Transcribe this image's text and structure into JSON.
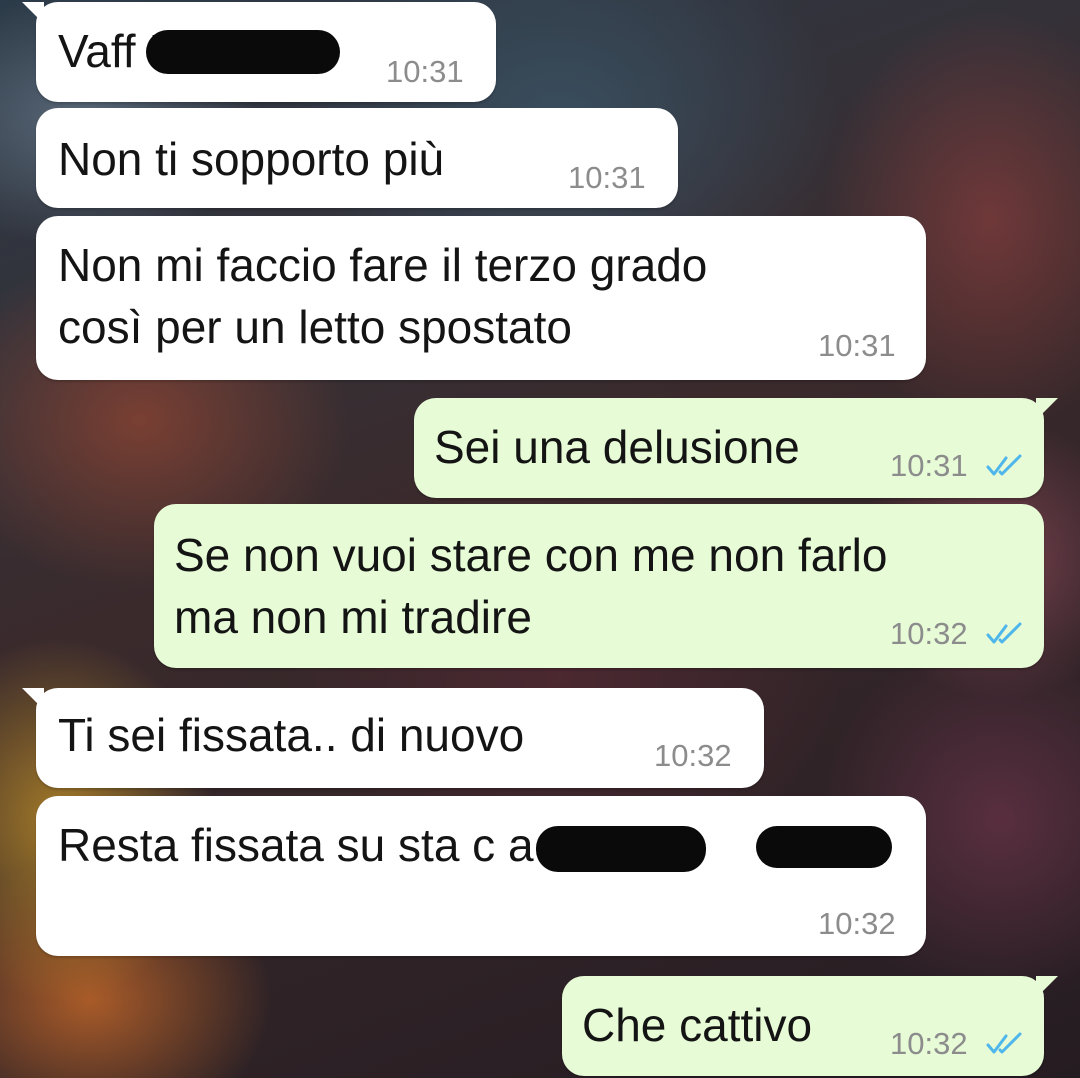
{
  "colors": {
    "incoming_bubble": "#ffffff",
    "outgoing_bubble": "#e6fbd6",
    "read_ticks": "#4fb6ec",
    "timestamp": "#8c8c8c"
  },
  "messages": [
    {
      "direction": "incoming",
      "lines": [
        "Vaff        !"
      ],
      "time": "10:31",
      "note_icon": "redaction-scribble"
    },
    {
      "direction": "incoming",
      "lines": [
        "Non ti sopporto più"
      ],
      "time": "10:31"
    },
    {
      "direction": "incoming",
      "lines": [
        "Non mi faccio fare il terzo grado",
        "così per un letto spostato"
      ],
      "time": "10:31"
    },
    {
      "direction": "outgoing",
      "lines": [
        "Sei una delusione"
      ],
      "time": "10:31",
      "status_icon": "double-check-read-icon"
    },
    {
      "direction": "outgoing",
      "lines": [
        "Se non vuoi stare con me non farlo",
        "ma non mi tradire"
      ],
      "time": "10:32",
      "status_icon": "double-check-read-icon"
    },
    {
      "direction": "incoming",
      "lines": [
        "Ti sei fissata.. di nuovo"
      ],
      "time": "10:32"
    },
    {
      "direction": "incoming",
      "lines": [
        "Resta fissata su sta c          a st        !"
      ],
      "time": "10:32",
      "note_icon": "redaction-scribble"
    },
    {
      "direction": "outgoing",
      "lines": [
        "Che cattivo"
      ],
      "time": "10:32",
      "status_icon": "double-check-read-icon"
    }
  ]
}
